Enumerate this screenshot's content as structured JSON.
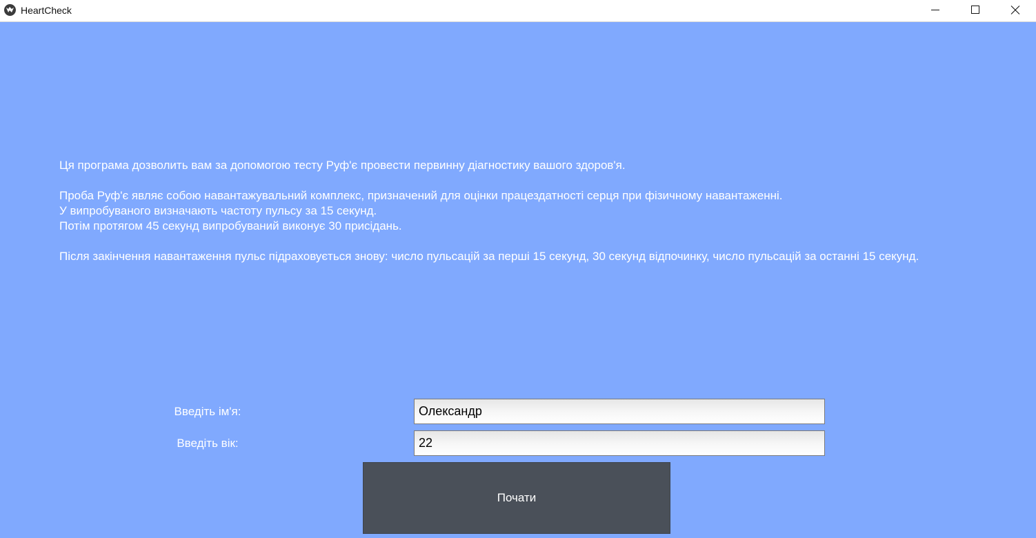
{
  "window": {
    "title": "HeartCheck",
    "icon": "kivy-app-icon",
    "controls": [
      "minimize-icon",
      "maximize-icon",
      "close-icon"
    ]
  },
  "intro": {
    "line1": "Ця програма дозволить вам за допомогою тесту Руф'є провести первинну діагностику вашого здоров'я.",
    "line2": "Проба Руф'є являє собою навантажувальний комплекс, призначений для оцінки працездатності серця при фізичному навантаженні.",
    "line3": "У випробуваного визначають частоту пульсу за 15 секунд.",
    "line4": "Потім протягом 45 секунд випробуваний виконує 30 присідань.",
    "line5": "Після закінчення навантаження пульс підраховується знову: число пульсацій за перші 15 секунд, 30 секунд відпочинку, число пульсацій за останні 15 секунд."
  },
  "form": {
    "name_label": "Введіть ім'я:",
    "name_value": "Олександр",
    "age_label": "Введіть вік:",
    "age_value": "22",
    "start_label": "Почати"
  },
  "colors": {
    "background": "#80a9fe",
    "button": "#4a5059"
  }
}
